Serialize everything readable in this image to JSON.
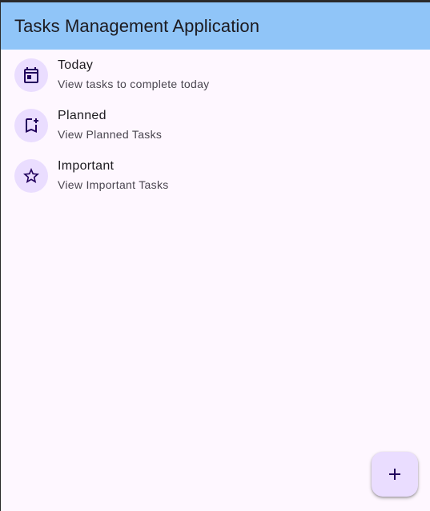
{
  "app_bar": {
    "title": "Tasks Management Application"
  },
  "list": {
    "items": [
      {
        "headline": "Today",
        "supporting": "View tasks to complete today",
        "icon": "calendar-today-icon"
      },
      {
        "headline": "Planned",
        "supporting": "View Planned Tasks",
        "icon": "bookmark-add-icon"
      },
      {
        "headline": "Important",
        "supporting": "View Important Tasks",
        "icon": "star-outline-icon"
      }
    ]
  },
  "fab": {
    "icon": "add-icon"
  },
  "colors": {
    "app_bar": "#90c5f8",
    "surface": "#fef7ff",
    "avatar_bg": "#eaddff",
    "icon": "#21005d",
    "text_primary": "#1d1b20",
    "text_secondary": "#49454f"
  }
}
